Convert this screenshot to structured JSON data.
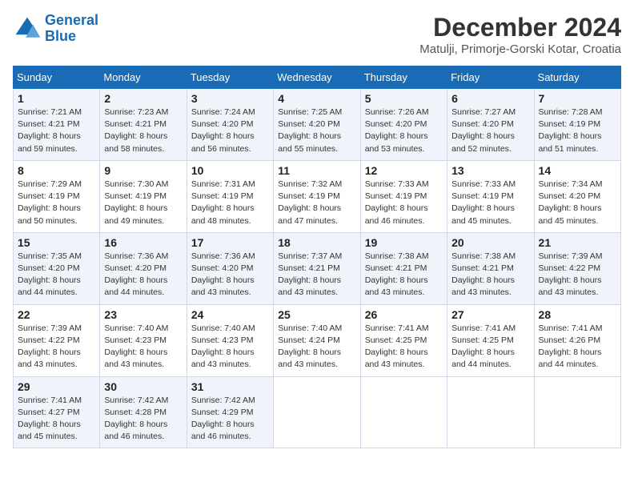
{
  "logo": {
    "line1": "General",
    "line2": "Blue"
  },
  "title": "December 2024",
  "location": "Matulji, Primorje-Gorski Kotar, Croatia",
  "weekdays": [
    "Sunday",
    "Monday",
    "Tuesday",
    "Wednesday",
    "Thursday",
    "Friday",
    "Saturday"
  ],
  "weeks": [
    [
      {
        "day": "1",
        "info": "Sunrise: 7:21 AM\nSunset: 4:21 PM\nDaylight: 8 hours\nand 59 minutes."
      },
      {
        "day": "2",
        "info": "Sunrise: 7:23 AM\nSunset: 4:21 PM\nDaylight: 8 hours\nand 58 minutes."
      },
      {
        "day": "3",
        "info": "Sunrise: 7:24 AM\nSunset: 4:20 PM\nDaylight: 8 hours\nand 56 minutes."
      },
      {
        "day": "4",
        "info": "Sunrise: 7:25 AM\nSunset: 4:20 PM\nDaylight: 8 hours\nand 55 minutes."
      },
      {
        "day": "5",
        "info": "Sunrise: 7:26 AM\nSunset: 4:20 PM\nDaylight: 8 hours\nand 53 minutes."
      },
      {
        "day": "6",
        "info": "Sunrise: 7:27 AM\nSunset: 4:20 PM\nDaylight: 8 hours\nand 52 minutes."
      },
      {
        "day": "7",
        "info": "Sunrise: 7:28 AM\nSunset: 4:19 PM\nDaylight: 8 hours\nand 51 minutes."
      }
    ],
    [
      {
        "day": "8",
        "info": "Sunrise: 7:29 AM\nSunset: 4:19 PM\nDaylight: 8 hours\nand 50 minutes."
      },
      {
        "day": "9",
        "info": "Sunrise: 7:30 AM\nSunset: 4:19 PM\nDaylight: 8 hours\nand 49 minutes."
      },
      {
        "day": "10",
        "info": "Sunrise: 7:31 AM\nSunset: 4:19 PM\nDaylight: 8 hours\nand 48 minutes."
      },
      {
        "day": "11",
        "info": "Sunrise: 7:32 AM\nSunset: 4:19 PM\nDaylight: 8 hours\nand 47 minutes."
      },
      {
        "day": "12",
        "info": "Sunrise: 7:33 AM\nSunset: 4:19 PM\nDaylight: 8 hours\nand 46 minutes."
      },
      {
        "day": "13",
        "info": "Sunrise: 7:33 AM\nSunset: 4:19 PM\nDaylight: 8 hours\nand 45 minutes."
      },
      {
        "day": "14",
        "info": "Sunrise: 7:34 AM\nSunset: 4:20 PM\nDaylight: 8 hours\nand 45 minutes."
      }
    ],
    [
      {
        "day": "15",
        "info": "Sunrise: 7:35 AM\nSunset: 4:20 PM\nDaylight: 8 hours\nand 44 minutes."
      },
      {
        "day": "16",
        "info": "Sunrise: 7:36 AM\nSunset: 4:20 PM\nDaylight: 8 hours\nand 44 minutes."
      },
      {
        "day": "17",
        "info": "Sunrise: 7:36 AM\nSunset: 4:20 PM\nDaylight: 8 hours\nand 43 minutes."
      },
      {
        "day": "18",
        "info": "Sunrise: 7:37 AM\nSunset: 4:21 PM\nDaylight: 8 hours\nand 43 minutes."
      },
      {
        "day": "19",
        "info": "Sunrise: 7:38 AM\nSunset: 4:21 PM\nDaylight: 8 hours\nand 43 minutes."
      },
      {
        "day": "20",
        "info": "Sunrise: 7:38 AM\nSunset: 4:21 PM\nDaylight: 8 hours\nand 43 minutes."
      },
      {
        "day": "21",
        "info": "Sunrise: 7:39 AM\nSunset: 4:22 PM\nDaylight: 8 hours\nand 43 minutes."
      }
    ],
    [
      {
        "day": "22",
        "info": "Sunrise: 7:39 AM\nSunset: 4:22 PM\nDaylight: 8 hours\nand 43 minutes."
      },
      {
        "day": "23",
        "info": "Sunrise: 7:40 AM\nSunset: 4:23 PM\nDaylight: 8 hours\nand 43 minutes."
      },
      {
        "day": "24",
        "info": "Sunrise: 7:40 AM\nSunset: 4:23 PM\nDaylight: 8 hours\nand 43 minutes."
      },
      {
        "day": "25",
        "info": "Sunrise: 7:40 AM\nSunset: 4:24 PM\nDaylight: 8 hours\nand 43 minutes."
      },
      {
        "day": "26",
        "info": "Sunrise: 7:41 AM\nSunset: 4:25 PM\nDaylight: 8 hours\nand 43 minutes."
      },
      {
        "day": "27",
        "info": "Sunrise: 7:41 AM\nSunset: 4:25 PM\nDaylight: 8 hours\nand 44 minutes."
      },
      {
        "day": "28",
        "info": "Sunrise: 7:41 AM\nSunset: 4:26 PM\nDaylight: 8 hours\nand 44 minutes."
      }
    ],
    [
      {
        "day": "29",
        "info": "Sunrise: 7:41 AM\nSunset: 4:27 PM\nDaylight: 8 hours\nand 45 minutes."
      },
      {
        "day": "30",
        "info": "Sunrise: 7:42 AM\nSunset: 4:28 PM\nDaylight: 8 hours\nand 46 minutes."
      },
      {
        "day": "31",
        "info": "Sunrise: 7:42 AM\nSunset: 4:29 PM\nDaylight: 8 hours\nand 46 minutes."
      },
      null,
      null,
      null,
      null
    ]
  ]
}
